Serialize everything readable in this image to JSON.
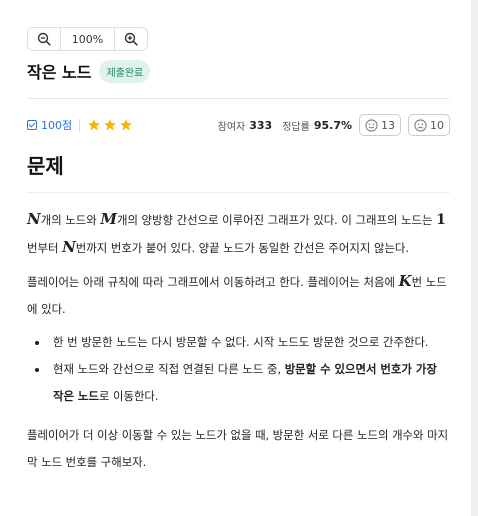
{
  "zoom": {
    "minus_icon": "zoom-out-icon",
    "value": "100%",
    "plus_icon": "zoom-in-icon"
  },
  "problem": {
    "title": "작은 노드",
    "badge": "제출완료"
  },
  "meta": {
    "points": "100점",
    "stars": 3,
    "participants_label": "참여자",
    "participants": "333",
    "accuracy_label": "정답률",
    "accuracy": "95.7%",
    "likes": "13",
    "dislikes": "10"
  },
  "section_title": "문제",
  "statement": {
    "p1": {
      "v1": "N",
      "t1": "개의 노드와 ",
      "v2": "M",
      "t2": "개의 양방향 간선으로 이루어진 그래프가 있다. 이 그래프의 노드는 ",
      "n1": "1",
      "t3": "번부터 ",
      "v3": "N",
      "t4": "번까지 번호가 붙어 있다. 양끝 노드가 동일한 간선은 주어지지 않는다."
    },
    "p2": {
      "t1": "플레이어는 아래 규칙에 따라 그래프에서 이동하려고 한다. 플레이어는 처음에 ",
      "v1": "K",
      "t2": "번 노드에 있다."
    },
    "rules": {
      "r1": "한 번 방문한 노드는 다시 방문할 수 없다. 시작 노드도 방문한 것으로 간주한다.",
      "r2_t1": "현재 노드와 간선으로 직접 연결된 다른 노드 중, ",
      "r2_b": "방문할 수 있으면서 번호가 가장 작은 노드",
      "r2_t2": "로 이동한다."
    },
    "p3": "플레이어가 더 이상 이동할 수 있는 노드가 없을 때, 방문한 서로 다른 노드의 개수와 마지막 노드 번호를 구해보자."
  },
  "colors": {
    "accent": "#2f6fd6",
    "star": "#f5b800",
    "badge_text": "#1e8a6a",
    "badge_bg": "#dff3ea"
  }
}
